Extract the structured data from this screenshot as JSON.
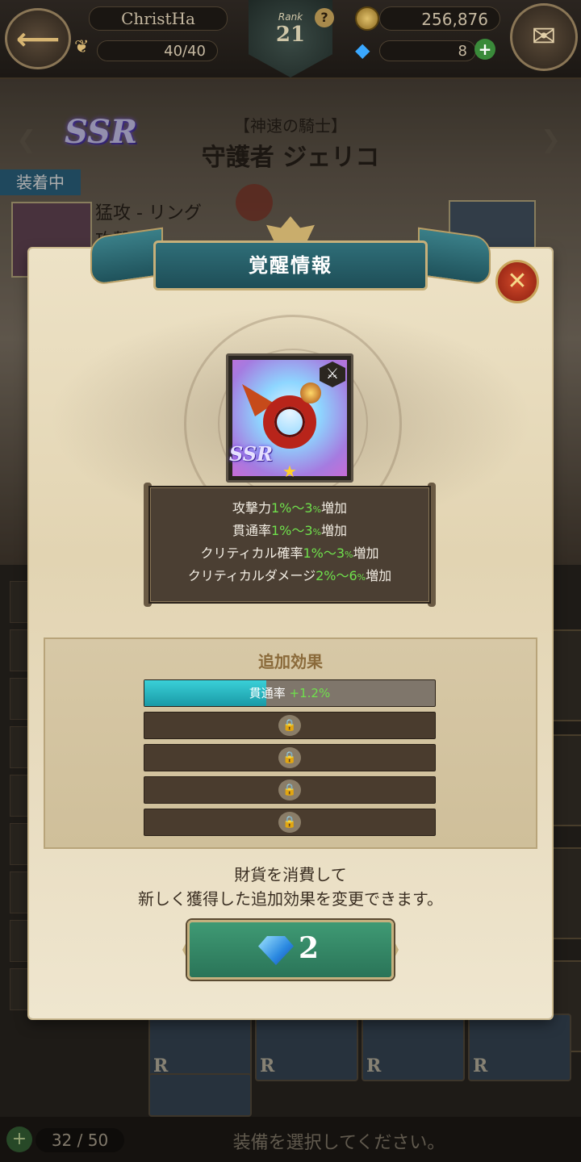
{
  "header": {
    "player_name": "ChristHa",
    "stamina": "40/40",
    "rank_label": "Rank",
    "rank": "21",
    "help": "?",
    "gold": "256,876",
    "gems": "8"
  },
  "character": {
    "title": "【神速の騎士】",
    "name": "守護者 ジェリコ"
  },
  "background": {
    "equipped_label": "装着中",
    "item_name": "猛攻 - リング",
    "item_sub": "攻撃",
    "inventory_count": "32 / 50",
    "select_prompt": "装備を選択してください。",
    "rarity_r": "R",
    "rarity_ssr": "SSR"
  },
  "modal": {
    "title": "覚醒情報",
    "close_icon": "✕",
    "item_rarity": "SSR",
    "item_star": "★",
    "stats": [
      {
        "name": "攻撃力",
        "range": "1%～3",
        "pct": "%",
        "suffix": "増加"
      },
      {
        "name": "貫通率",
        "range": "1%～3",
        "pct": "%",
        "suffix": "増加"
      },
      {
        "name": "クリティカル確率",
        "range": "1%～3",
        "pct": "%",
        "suffix": "増加"
      },
      {
        "name": "クリティカルダメージ",
        "range": "2%～6",
        "pct": "%",
        "suffix": "増加"
      }
    ],
    "effects_title": "追加効果",
    "effect_slots": [
      {
        "name": "貫通率",
        "value": "+1.2%",
        "fill": 0.42,
        "locked": false
      },
      {
        "locked": true
      },
      {
        "locked": true
      },
      {
        "locked": true
      },
      {
        "locked": true
      }
    ],
    "description_line1": "財貨を消費して",
    "description_line2": "新しく獲得した追加効果を変更できます。",
    "cost": "2",
    "cost_icon": "diamond-gem-icon"
  },
  "colors": {
    "accent_teal": "#2f6e78",
    "stat_green": "#6fe14c",
    "button_green": "#3f9a74"
  }
}
